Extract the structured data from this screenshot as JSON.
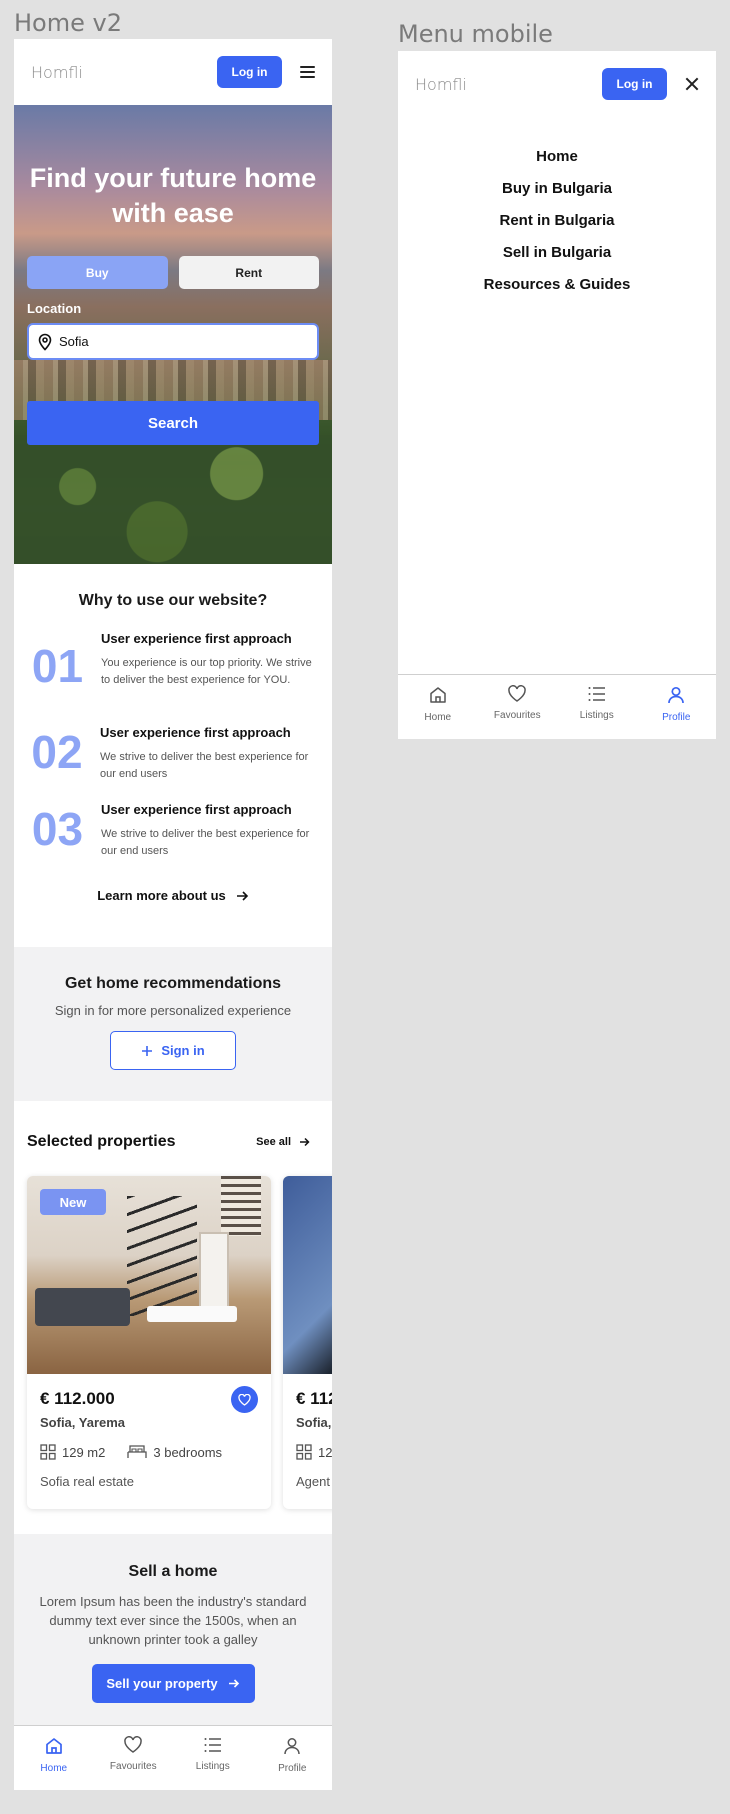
{
  "frames": {
    "home_label": "Home v2",
    "menu_label": "Menu mobile"
  },
  "header": {
    "logo": "Homfli",
    "login_label": "Log in"
  },
  "hero": {
    "title": "Find your future home with ease",
    "buy_label": "Buy",
    "rent_label": "Rent",
    "location_label": "Location",
    "location_value": "Sofia",
    "search_label": "Search"
  },
  "why": {
    "title": "Why to use our website?",
    "items": [
      {
        "num": "01",
        "title": "User experience first approach",
        "text": "You experience is our top priority. We strive to deliver the best experience for YOU."
      },
      {
        "num": "02",
        "title": "User experience first approach",
        "text": "We strive to deliver the best experience for our end users"
      },
      {
        "num": "03",
        "title": "User experience first approach",
        "text": "We strive to deliver the best experience for our end users"
      }
    ],
    "learn_more": "Learn more about us"
  },
  "reco": {
    "title": "Get home recommendations",
    "subtitle": "Sign in for more personalized experience",
    "signin_label": "Sign in"
  },
  "properties": {
    "title": "Selected properties",
    "see_all": "See all",
    "cards": [
      {
        "badge": "New",
        "price": "€ 112.000",
        "address": "Sofia, Yarema",
        "area": "129 m2",
        "bedrooms": "3 bedrooms",
        "agent": "Sofia real estate"
      },
      {
        "price": "€ 112",
        "address": "Sofia,",
        "area": "12",
        "agent": "Agent"
      }
    ]
  },
  "sell": {
    "title": "Sell a home",
    "text": "Lorem Ipsum has been the industry's standard dummy text ever since the 1500s, when an unknown printer took a galley",
    "button": "Sell your property"
  },
  "tabbar": {
    "home": "Home",
    "favourites": "Favourites",
    "listings": "Listings",
    "profile": "Profile"
  },
  "menu": {
    "items": [
      "Home",
      "Buy in Bulgaria",
      "Rent in Bulgaria",
      "Sell in Bulgaria",
      "Resources & Guides"
    ]
  },
  "colors": {
    "accent": "#3a64f2",
    "accent_light": "#8da5f5"
  }
}
